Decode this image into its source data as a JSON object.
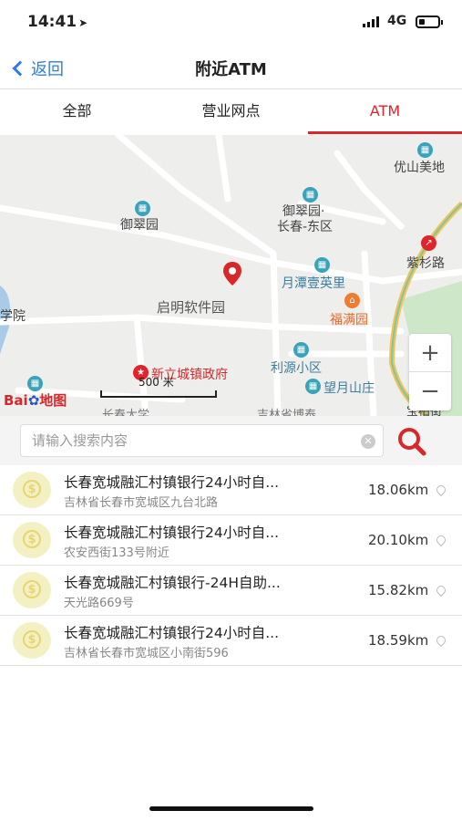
{
  "status_bar": {
    "time": "14:41",
    "network": "4G",
    "battery_level": 0.3
  },
  "nav": {
    "back_label": "返回",
    "title": "附近ATM"
  },
  "tabs": [
    {
      "label": "全部",
      "active": false
    },
    {
      "label": "营业网点",
      "active": false
    },
    {
      "label": "ATM",
      "active": true
    }
  ],
  "map": {
    "pois": [
      "优山美地",
      "御翠园",
      "御翠园·",
      "长春-东区",
      "紫杉路",
      "月潭壹英里",
      "福满园",
      "启明软件园",
      "学院",
      "利源小区",
      "新立城镇政府",
      "望月山庄",
      "宝柏街",
      "长春大学",
      "吉林省博泰"
    ],
    "scale_label": "500 米",
    "logo_text": "Bai",
    "logo_suffix": "地图",
    "zoom_in": "+",
    "zoom_out": "−"
  },
  "search": {
    "placeholder": "请输入搜索内容"
  },
  "atm_list": [
    {
      "name": "长春宽城融汇村镇银行24小时自...",
      "address": "吉林省长春市宽城区九台北路",
      "distance": "18.06km"
    },
    {
      "name": "长春宽城融汇村镇银行24小时自...",
      "address": "农安西街133号附近",
      "distance": "20.10km"
    },
    {
      "name": "长春宽城融汇村镇银行-24H自助...",
      "address": "天光路669号",
      "distance": "15.82km"
    },
    {
      "name": "长春宽城融汇村镇银行24小时自...",
      "address": "吉林省长春市宽城区小南街596",
      "distance": "18.59km"
    }
  ],
  "colors": {
    "accent": "#e0242b",
    "back": "#2f7de1"
  }
}
